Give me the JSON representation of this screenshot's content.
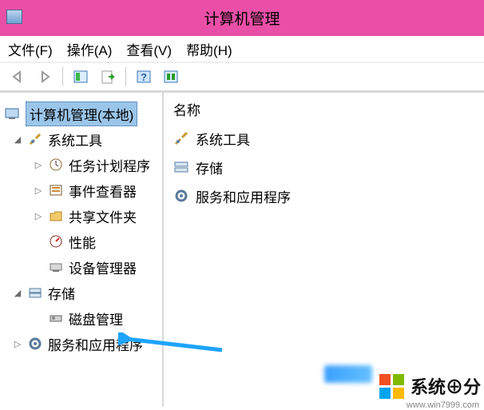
{
  "titlebar": {
    "title": "计算机管理"
  },
  "menubar": {
    "file": "文件(F)",
    "action": "操作(A)",
    "view": "查看(V)",
    "help": "帮助(H)"
  },
  "tree": {
    "root": "计算机管理(本地)",
    "system_tools": "系统工具",
    "task_scheduler": "任务计划程序",
    "event_viewer": "事件查看器",
    "shared_folders": "共享文件夹",
    "performance": "性能",
    "device_manager": "设备管理器",
    "storage": "存储",
    "disk_mgmt": "磁盘管理",
    "services_apps": "服务和应用程序"
  },
  "list": {
    "header": "名称",
    "items": [
      "系统工具",
      "存储",
      "服务和应用程序"
    ]
  },
  "watermark": {
    "text": "系统⊕分",
    "url": "www.win7999.com"
  }
}
